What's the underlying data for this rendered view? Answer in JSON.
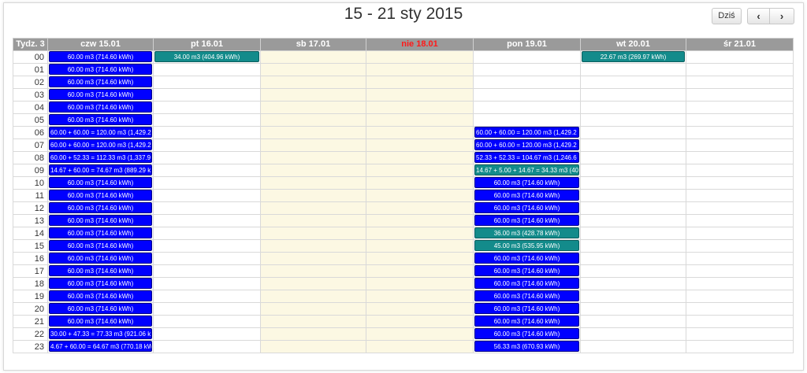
{
  "header": {
    "title": "15 - 21 sty 2015",
    "today_label": "Dziś",
    "prev_icon": "chevron-left-icon",
    "next_icon": "chevron-right-icon"
  },
  "colors": {
    "event_blue": "#0000ff",
    "event_teal": "#138b8b",
    "weekend_bg": "#fcf8e3",
    "holiday_text": "#ff1a1a",
    "header_bg": "#9a9a9a"
  },
  "columns": {
    "week": "Tydz. 3",
    "days": [
      {
        "label": "czw 15.01",
        "weekend": false,
        "holiday": false
      },
      {
        "label": "pt 16.01",
        "weekend": false,
        "holiday": false
      },
      {
        "label": "sb 17.01",
        "weekend": true,
        "holiday": false
      },
      {
        "label": "nie 18.01",
        "weekend": true,
        "holiday": true
      },
      {
        "label": "pon 19.01",
        "weekend": false,
        "holiday": false
      },
      {
        "label": "wt 20.01",
        "weekend": false,
        "holiday": false
      },
      {
        "label": "śr 21.01",
        "weekend": false,
        "holiday": false
      }
    ]
  },
  "hours": [
    "00",
    "01",
    "02",
    "03",
    "04",
    "05",
    "06",
    "07",
    "08",
    "09",
    "10",
    "11",
    "12",
    "13",
    "14",
    "15",
    "16",
    "17",
    "18",
    "19",
    "20",
    "21",
    "22",
    "23"
  ],
  "events": [
    {
      "day": 0,
      "hour": 0,
      "text": "60.00 m3 (714.60 kWh)",
      "color": "blue",
      "align": "c"
    },
    {
      "day": 0,
      "hour": 1,
      "text": "60.00 m3 (714.60 kWh)",
      "color": "blue",
      "align": "c"
    },
    {
      "day": 0,
      "hour": 2,
      "text": "60.00 m3 (714.60 kWh)",
      "color": "blue",
      "align": "c"
    },
    {
      "day": 0,
      "hour": 3,
      "text": "60.00 m3 (714.60 kWh)",
      "color": "blue",
      "align": "c"
    },
    {
      "day": 0,
      "hour": 4,
      "text": "60.00 m3 (714.60 kWh)",
      "color": "blue",
      "align": "c"
    },
    {
      "day": 0,
      "hour": 5,
      "text": "60.00 m3 (714.60 kWh)",
      "color": "blue",
      "align": "c"
    },
    {
      "day": 0,
      "hour": 6,
      "text": "60.00 + 60.00 = 120.00 m3 (1,429.2",
      "color": "blue",
      "align": "l"
    },
    {
      "day": 0,
      "hour": 7,
      "text": "60.00 + 60.00 = 120.00 m3 (1,429.2",
      "color": "blue",
      "align": "l"
    },
    {
      "day": 0,
      "hour": 8,
      "text": "60.00 + 52.33 = 112.33 m3 (1,337.9",
      "color": "blue",
      "align": "l"
    },
    {
      "day": 0,
      "hour": 9,
      "text": "14.67 + 60.00 = 74.67 m3 (889.29 k",
      "color": "blue",
      "align": "l"
    },
    {
      "day": 0,
      "hour": 10,
      "text": "60.00 m3 (714.60 kWh)",
      "color": "blue",
      "align": "c"
    },
    {
      "day": 0,
      "hour": 11,
      "text": "60.00 m3 (714.60 kWh)",
      "color": "blue",
      "align": "c"
    },
    {
      "day": 0,
      "hour": 12,
      "text": "60.00 m3 (714.60 kWh)",
      "color": "blue",
      "align": "c"
    },
    {
      "day": 0,
      "hour": 13,
      "text": "60.00 m3 (714.60 kWh)",
      "color": "blue",
      "align": "c"
    },
    {
      "day": 0,
      "hour": 14,
      "text": "60.00 m3 (714.60 kWh)",
      "color": "blue",
      "align": "c"
    },
    {
      "day": 0,
      "hour": 15,
      "text": "60.00 m3 (714.60 kWh)",
      "color": "blue",
      "align": "c"
    },
    {
      "day": 0,
      "hour": 16,
      "text": "60.00 m3 (714.60 kWh)",
      "color": "blue",
      "align": "c"
    },
    {
      "day": 0,
      "hour": 17,
      "text": "60.00 m3 (714.60 kWh)",
      "color": "blue",
      "align": "c"
    },
    {
      "day": 0,
      "hour": 18,
      "text": "60.00 m3 (714.60 kWh)",
      "color": "blue",
      "align": "c"
    },
    {
      "day": 0,
      "hour": 19,
      "text": "60.00 m3 (714.60 kWh)",
      "color": "blue",
      "align": "c"
    },
    {
      "day": 0,
      "hour": 20,
      "text": "60.00 m3 (714.60 kWh)",
      "color": "blue",
      "align": "c"
    },
    {
      "day": 0,
      "hour": 21,
      "text": "60.00 m3 (714.60 kWh)",
      "color": "blue",
      "align": "c"
    },
    {
      "day": 0,
      "hour": 22,
      "text": "30.00 + 47.33 = 77.33 m3 (921.06 k",
      "color": "blue",
      "align": "l"
    },
    {
      "day": 0,
      "hour": 23,
      "text": "4.67 + 60.00 = 64.67 m3 (770.18 kW",
      "color": "blue",
      "align": "l"
    },
    {
      "day": 1,
      "hour": 0,
      "text": "34.00 m3 (404.96 kWh)",
      "color": "teal",
      "align": "c"
    },
    {
      "day": 4,
      "hour": 6,
      "text": "60.00 + 60.00 = 120.00 m3 (1,429.2",
      "color": "blue",
      "align": "l"
    },
    {
      "day": 4,
      "hour": 7,
      "text": "60.00 + 60.00 = 120.00 m3 (1,429.2",
      "color": "blue",
      "align": "l"
    },
    {
      "day": 4,
      "hour": 8,
      "text": "52.33 + 52.33 = 104.67 m3 (1,246.6",
      "color": "blue",
      "align": "l"
    },
    {
      "day": 4,
      "hour": 9,
      "text": "14.67 + 5.00 + 14.67 = 34.33 m3 (40",
      "color": "teal",
      "align": "l"
    },
    {
      "day": 4,
      "hour": 10,
      "text": "60.00 m3 (714.60 kWh)",
      "color": "blue",
      "align": "c"
    },
    {
      "day": 4,
      "hour": 11,
      "text": "60.00 m3 (714.60 kWh)",
      "color": "blue",
      "align": "c"
    },
    {
      "day": 4,
      "hour": 12,
      "text": "60.00 m3 (714.60 kWh)",
      "color": "blue",
      "align": "c"
    },
    {
      "day": 4,
      "hour": 13,
      "text": "60.00 m3 (714.60 kWh)",
      "color": "blue",
      "align": "c"
    },
    {
      "day": 4,
      "hour": 14,
      "text": "36.00 m3 (428.78 kWh)",
      "color": "teal",
      "align": "c"
    },
    {
      "day": 4,
      "hour": 15,
      "text": "45.00 m3 (535.95 kWh)",
      "color": "teal",
      "align": "c"
    },
    {
      "day": 4,
      "hour": 16,
      "text": "60.00 m3 (714.60 kWh)",
      "color": "blue",
      "align": "c"
    },
    {
      "day": 4,
      "hour": 17,
      "text": "60.00 m3 (714.60 kWh)",
      "color": "blue",
      "align": "c"
    },
    {
      "day": 4,
      "hour": 18,
      "text": "60.00 m3 (714.60 kWh)",
      "color": "blue",
      "align": "c"
    },
    {
      "day": 4,
      "hour": 19,
      "text": "60.00 m3 (714.60 kWh)",
      "color": "blue",
      "align": "c"
    },
    {
      "day": 4,
      "hour": 20,
      "text": "60.00 m3 (714.60 kWh)",
      "color": "blue",
      "align": "c"
    },
    {
      "day": 4,
      "hour": 21,
      "text": "60.00 m3 (714.60 kWh)",
      "color": "blue",
      "align": "c"
    },
    {
      "day": 4,
      "hour": 22,
      "text": "60.00 m3 (714.60 kWh)",
      "color": "blue",
      "align": "c"
    },
    {
      "day": 4,
      "hour": 23,
      "text": "56.33 m3 (670.93 kWh)",
      "color": "blue",
      "align": "c"
    },
    {
      "day": 5,
      "hour": 0,
      "text": "22.67 m3 (269.97 kWh)",
      "color": "teal",
      "align": "c"
    }
  ]
}
